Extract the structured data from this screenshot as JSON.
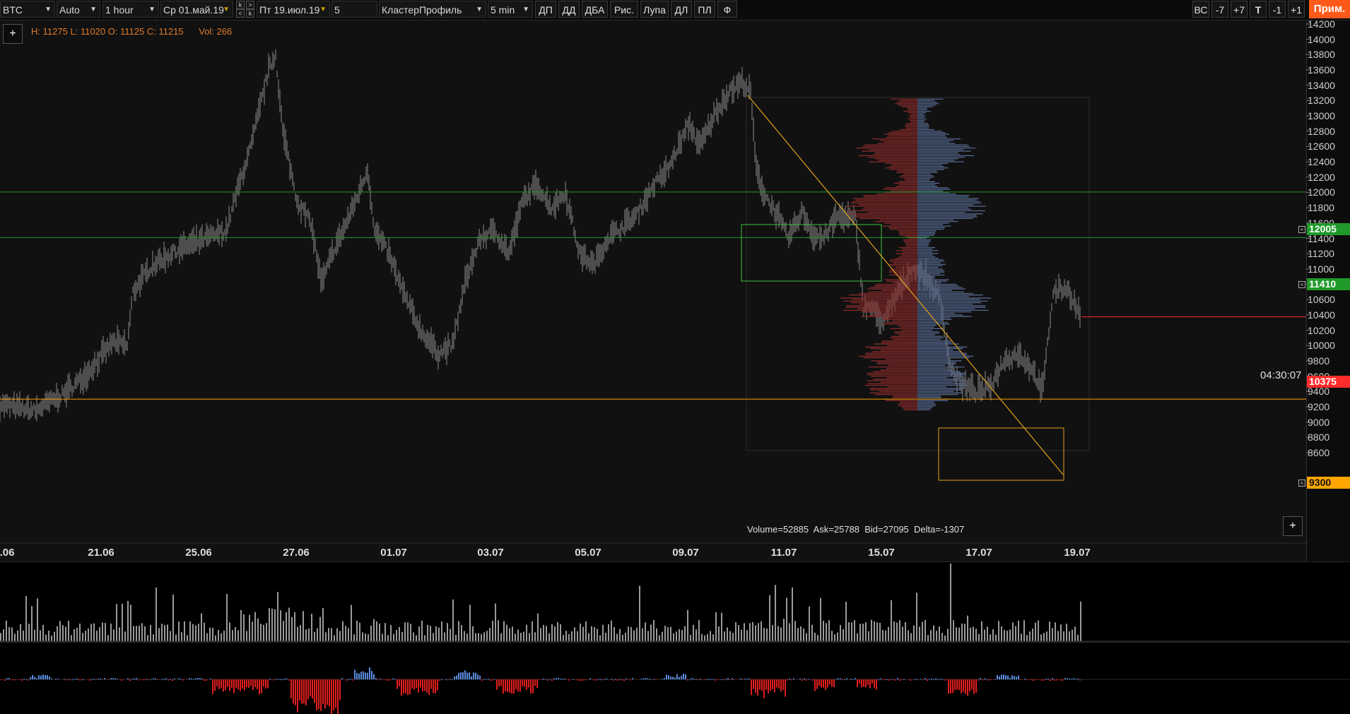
{
  "toolbar": {
    "symbol": "BTC",
    "scale": "Auto",
    "timeframe": "1 hour",
    "date_from": "Ср 01.май.19",
    "date_to": "Пт 19.июл.19",
    "nav_k1": "k",
    "nav_up": ">",
    "nav_left": "<",
    "nav_k2": "k",
    "count": "5",
    "template": "КластерПрофиль",
    "cluster_period": "5 min",
    "buttons": [
      "ДП",
      "ДД",
      "ДБА",
      "Рис.",
      "Лупа",
      "ДЛ",
      "ПЛ",
      "Ф"
    ],
    "right_buttons": [
      "ВС",
      "-7",
      "+7",
      "T",
      "-1",
      "+1"
    ],
    "apply": "Прим."
  },
  "chart": {
    "info": "H: 11275 L: 11020 O: 11125 C: 11215      Vol: 266",
    "stats": "Volume=52885  Ask=25788  Bid=27095  Delta=-1307",
    "timer": "04:30:07",
    "y_ticks": [
      "14200",
      "14000",
      "13800",
      "13600",
      "13400",
      "13200",
      "13000",
      "12800",
      "12600",
      "12400",
      "12200",
      "12000",
      "11800",
      "11600",
      "11400",
      "11200",
      "11000",
      "10800",
      "10600",
      "10400",
      "10200",
      "10000",
      "9800",
      "9600",
      "9400",
      "9200",
      "9000",
      "8800",
      "8600"
    ],
    "x_ticks": [
      ".06",
      "21.06",
      "25.06",
      "27.06",
      "01.07",
      "03.07",
      "05.07",
      "09.07",
      "11.07",
      "15.07",
      "17.07",
      "19.07"
    ],
    "level_labels": [
      "12005",
      "11410",
      "10375",
      "9300"
    ],
    "colors": {
      "green_level": "#1f9a2a",
      "red_level": "#ff2b2b",
      "orange_level": "#ffa500",
      "ask": "#6a7fb0",
      "bid": "#a52a2a"
    }
  }
}
